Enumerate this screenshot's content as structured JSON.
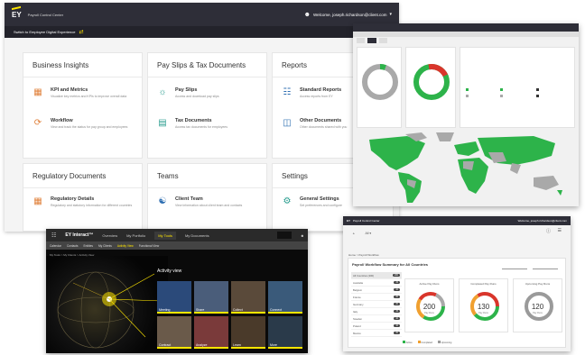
{
  "w1": {
    "header_title": "Payroll Control Center",
    "user_label": "Welcome, joseph.richardson@client.com",
    "switch_link": "Switch to Employee Digital Experience",
    "cards": [
      {
        "title": "Business Insights",
        "items": [
          {
            "icon": "chart-icon",
            "title": "KPI and Metrics",
            "desc": "Visualize key metrics and KPIs to improve overall data"
          },
          {
            "icon": "workflow-icon",
            "title": "Workflow",
            "desc": "View and track the status for pay group and employees"
          }
        ]
      },
      {
        "title": "Pay Slips & Tax Documents",
        "items": [
          {
            "icon": "payslip-icon",
            "title": "Pay Slips",
            "desc": "Access and download pay slips"
          },
          {
            "icon": "tax-document-icon",
            "title": "Tax Documents",
            "desc": "Access tax documents for employees"
          }
        ]
      },
      {
        "title": "Reports",
        "items": [
          {
            "icon": "report-icon",
            "title": "Standard Reports",
            "desc": "Access reports from EY"
          },
          {
            "icon": "document-icon",
            "title": "Other Documents",
            "desc": "Other documents shared with you"
          }
        ]
      },
      {
        "title": "Regulatory Documents",
        "items": [
          {
            "icon": "regulatory-icon",
            "title": "Regulatory Details",
            "desc": "Regulatory and statutory information for different countries"
          }
        ]
      },
      {
        "title": "Teams",
        "items": [
          {
            "icon": "team-icon",
            "title": "Client Team",
            "desc": "View information about client team and contacts"
          }
        ]
      },
      {
        "title": "Settings",
        "items": [
          {
            "icon": "settings-icon",
            "title": "General Settings",
            "desc": "Set preferences and configure"
          }
        ]
      }
    ]
  },
  "w3": {
    "brand": "EY Interact™",
    "top_tabs": [
      "Overview",
      "My Portfolio",
      "My Tools",
      "My Documents"
    ],
    "active_top_tab": "My Tools",
    "nav": [
      "Calendar",
      "Contacts",
      "Entities",
      "My Clients",
      "Activity View",
      "Functional View"
    ],
    "active_nav": "Activity View",
    "breadcrumb": "My Tools > My Clients > Activity View",
    "activity_title": "Activity view",
    "tiles": [
      {
        "label": "Meeting",
        "color": "#2b4a7a"
      },
      {
        "label": "Share",
        "color": "#4a5d7a"
      },
      {
        "label": "Collect",
        "color": "#5a4a3a"
      },
      {
        "label": "Connect",
        "color": "#3a5a7a"
      },
      {
        "label": "Contract",
        "color": "#6a5a4a"
      },
      {
        "label": "Analyze",
        "color": "#7a3a3a"
      },
      {
        "label": "Learn",
        "color": "#4a3a2a"
      },
      {
        "label": "More",
        "color": "#2a3a4a"
      }
    ]
  },
  "w4": {
    "header": "Payroll Control Center",
    "user": "Welcome, joseph.richardson@client.com",
    "filter_value": "All",
    "breadcrumb": "Home > Payroll Workflow",
    "title": "Payroll Workflow Summary for All Countries",
    "countries": [
      {
        "name": "All Countries (200)",
        "count": "200",
        "active": true
      },
      {
        "name": "Australia",
        "count": "15"
      },
      {
        "name": "Belgium",
        "count": "10"
      },
      {
        "name": "France",
        "count": "20"
      },
      {
        "name": "Germany",
        "count": "20"
      },
      {
        "name": "Italy",
        "count": "15"
      },
      {
        "name": "Sweden",
        "count": "10"
      },
      {
        "name": "Poland",
        "count": "10"
      },
      {
        "name": "Mexico",
        "count": "20"
      }
    ],
    "cards": [
      {
        "title": "Active Pay Runs",
        "value": "200",
        "caption": "Pay Runs"
      },
      {
        "title": "Completed Pay Runs",
        "value": "130",
        "caption": "Pay Runs"
      },
      {
        "title": "Upcoming Pay Runs",
        "value": "120",
        "caption": "Pay Runs"
      }
    ],
    "legend": [
      "Active",
      "Completed",
      "Upcoming"
    ],
    "accent": "#2e2e38"
  },
  "colors": {
    "ey_yellow": "#ffe600",
    "dark": "#2e2e38",
    "green": "#2db34a",
    "red": "#d9352b",
    "orange": "#f0a030",
    "grey": "#a9a9a9"
  }
}
